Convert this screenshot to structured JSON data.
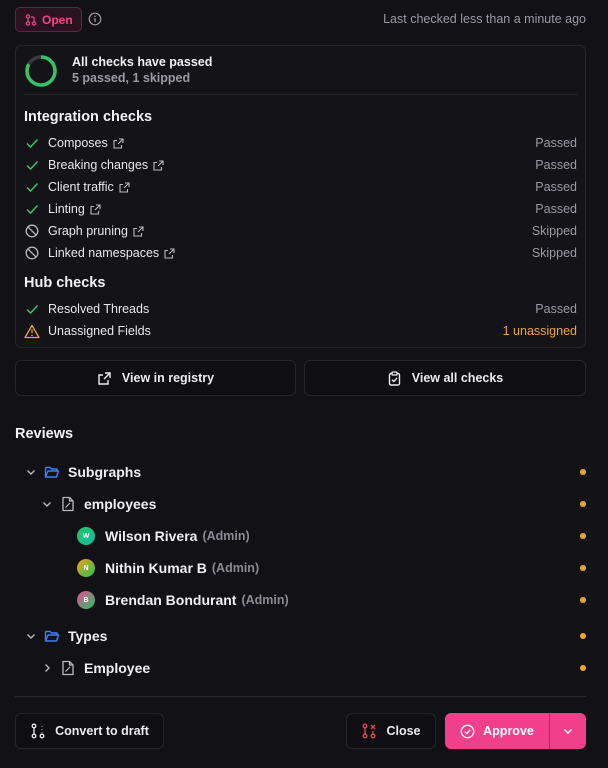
{
  "header": {
    "status_label": "Open",
    "last_checked": "Last checked less than a minute ago"
  },
  "summary": {
    "title": "All checks have passed",
    "subtitle": "5 passed, 1 skipped",
    "progress_fraction": 0.83
  },
  "integration": {
    "title": "Integration checks",
    "items": [
      {
        "label": "Composes",
        "status": "Passed",
        "state": "pass"
      },
      {
        "label": "Breaking changes",
        "status": "Passed",
        "state": "pass"
      },
      {
        "label": "Client traffic",
        "status": "Passed",
        "state": "pass"
      },
      {
        "label": "Linting",
        "status": "Passed",
        "state": "pass"
      },
      {
        "label": "Graph pruning",
        "status": "Skipped",
        "state": "skip"
      },
      {
        "label": "Linked namespaces",
        "status": "Skipped",
        "state": "skip"
      }
    ]
  },
  "hub": {
    "title": "Hub checks",
    "items": [
      {
        "label": "Resolved Threads",
        "status": "Passed",
        "state": "pass"
      },
      {
        "label": "Unassigned Fields",
        "status": "1 unassigned",
        "state": "warn"
      }
    ]
  },
  "actions": {
    "view_registry": "View in registry",
    "view_all_checks": "View all checks"
  },
  "reviews": {
    "title": "Reviews",
    "subgraphs": "Subgraphs",
    "employees": "employees",
    "reviewers": [
      {
        "initial": "W",
        "name": "Wilson Rivera",
        "role": "(Admin)"
      },
      {
        "initial": "N",
        "name": "Nithin Kumar B",
        "role": "(Admin)"
      },
      {
        "initial": "B",
        "name": "Brendan Bondurant",
        "role": "(Admin)"
      }
    ],
    "types": "Types",
    "employee": "Employee"
  },
  "footer": {
    "convert_label": "Convert to draft",
    "close_label": "Close",
    "approve_label": "Approve"
  },
  "colors": {
    "accent": "#f03f8b",
    "pass": "#37c26a",
    "warn": "#f0a432",
    "folder": "#3b82f6"
  }
}
